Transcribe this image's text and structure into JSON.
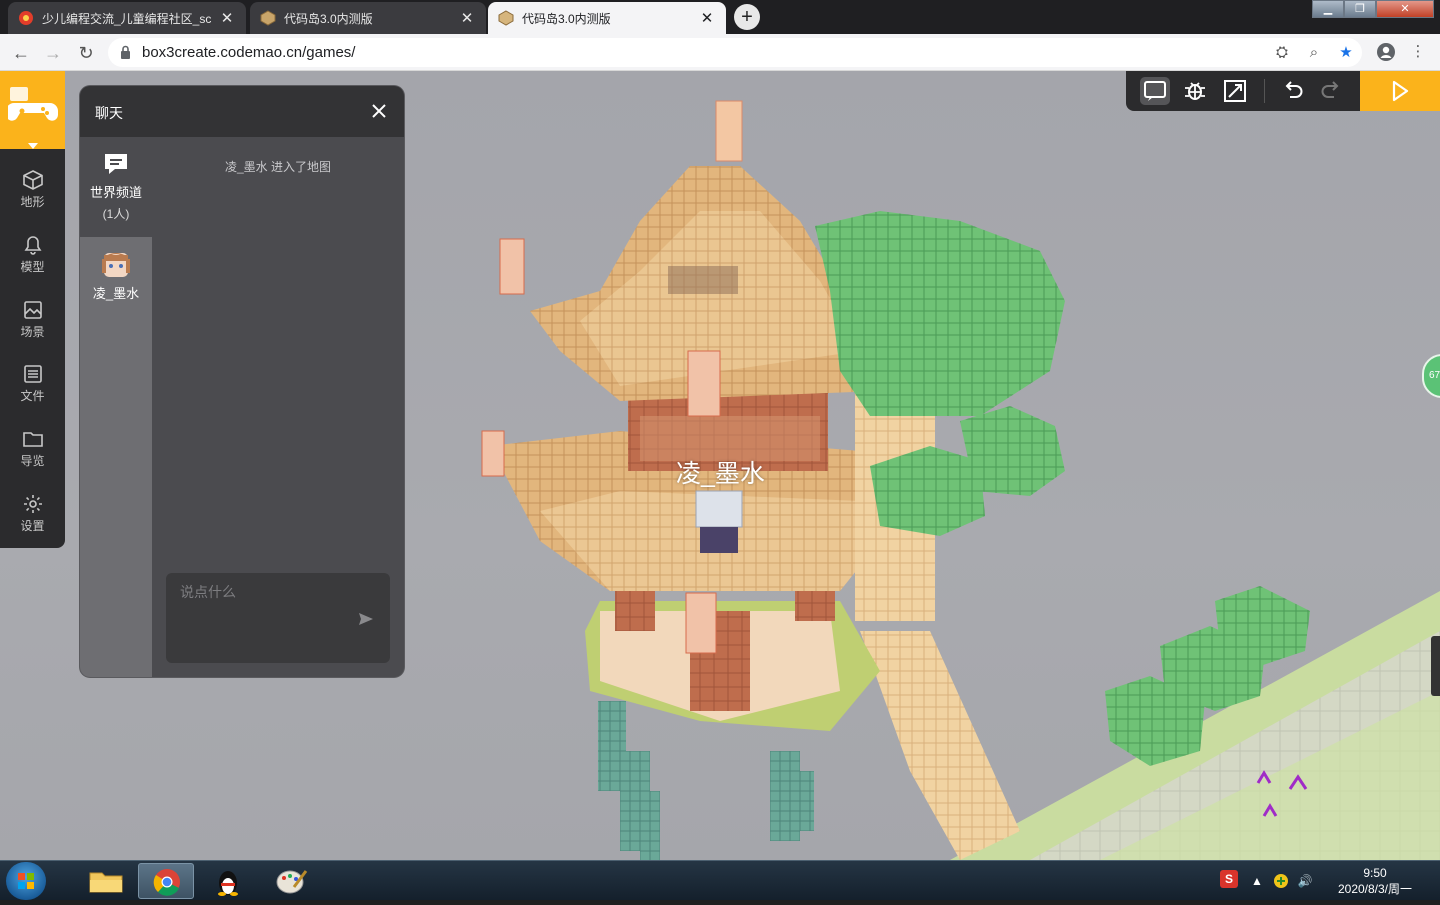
{
  "browser": {
    "tabs": [
      {
        "title": "少儿编程交流_儿童编程社区_sc",
        "active": false
      },
      {
        "title": "代码岛3.0内测版",
        "active": false
      },
      {
        "title": "代码岛3.0内测版",
        "active": true
      }
    ],
    "url": "box3create.codemao.cn/games/"
  },
  "sidebar": {
    "items": [
      {
        "label": "地形",
        "icon": "cube-icon"
      },
      {
        "label": "模型",
        "icon": "bell-icon"
      },
      {
        "label": "场景",
        "icon": "image-icon"
      },
      {
        "label": "文件",
        "icon": "file-list-icon"
      },
      {
        "label": "导览",
        "icon": "folder-icon"
      },
      {
        "label": "设置",
        "icon": "gear-icon"
      }
    ]
  },
  "chat": {
    "title": "聊天",
    "world_channel": {
      "label": "世界频道",
      "count": "(1人)"
    },
    "user": {
      "name": "凌_墨水"
    },
    "messages": [
      "凌_墨水 进入了地图"
    ],
    "input_placeholder": "说点什么"
  },
  "scene": {
    "player_name": "凌_墨水",
    "fps": "67"
  },
  "taskbar": {
    "time": "9:50",
    "date": "2020/8/3/周一"
  },
  "colors": {
    "accent": "#fbb31b",
    "panel_dark": "#2b2b2d",
    "chat_bg": "#4b4b4f"
  }
}
